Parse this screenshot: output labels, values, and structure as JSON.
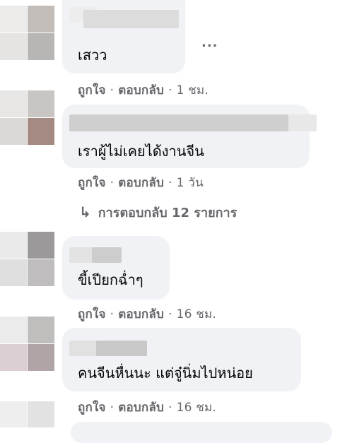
{
  "comments": [
    {
      "text": "เสวว",
      "actions": {
        "like": "ถูกใจ",
        "reply": "ตอบกลับ",
        "time": "1 ชม."
      },
      "more_icon": "ellipsis-icon"
    },
    {
      "text": "เราผู้ไม่เคยได้งานจีน",
      "actions": {
        "like": "ถูกใจ",
        "reply": "ตอบกลับ",
        "time": "1 วัน"
      },
      "replies_label": "การตอบกลับ 12 รายการ",
      "replies_icon": "reply-arrow-icon"
    },
    {
      "text": "ขี้เปียกฉ่ำๆ",
      "actions": {
        "like": "ถูกใจ",
        "reply": "ตอบกลับ",
        "time": "16 ชม."
      }
    },
    {
      "text": "คนจีนหื่นนะ แต่จู๋นิ่มไปหน่อย",
      "actions": {
        "like": "ถูกใจ",
        "reply": "ตอบกลับ",
        "time": "16 ชม."
      }
    }
  ],
  "separator": "·",
  "ellipsis": "...",
  "reply_arrow": "↳",
  "colors": {
    "bubble": "#f0f2f5",
    "meta_text": "#65676b",
    "body_text": "#050505"
  }
}
